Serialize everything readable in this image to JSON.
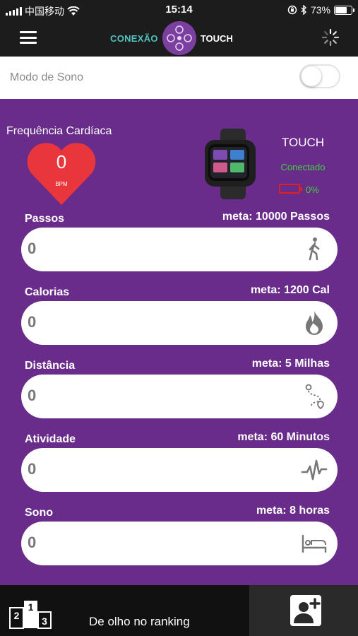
{
  "status_bar": {
    "carrier": "中国移动",
    "time": "15:14",
    "battery_pct": "73%"
  },
  "navbar": {
    "logo_left": "CONEXÃO",
    "logo_right": "TOUCH"
  },
  "sleep_mode": {
    "label": "Modo de Sono",
    "enabled": false
  },
  "heart_rate": {
    "title": "Frequência Cardíaca",
    "value": "0",
    "unit": "BPM",
    "color": "#e8363c"
  },
  "device": {
    "name": "TOUCH",
    "status": "Conectado",
    "battery": "0%"
  },
  "metrics": [
    {
      "label": "Passos",
      "goal": "meta: 10000 Passos",
      "value": "0",
      "icon": "walking-icon"
    },
    {
      "label": "Calorias",
      "goal": "meta: 1200 Cal",
      "value": "0",
      "icon": "flame-icon"
    },
    {
      "label": "Distância",
      "goal": "meta: 5 Milhas",
      "value": "0",
      "icon": "route-icon"
    },
    {
      "label": "Atividade",
      "goal": "meta: 60 Minutos",
      "value": "0",
      "icon": "pulse-icon"
    },
    {
      "label": "Sono",
      "goal": "meta: 8 horas",
      "value": "0",
      "icon": "bed-icon"
    }
  ],
  "bottom_bar": {
    "ranking_label": "De olho no ranking",
    "podium_numbers": [
      "2",
      "1",
      "3"
    ]
  },
  "colors": {
    "panel": "#6a2c8a",
    "accent_teal": "#4fc3c0",
    "status_green": "#3bd43b",
    "battery_red": "#e02020"
  }
}
